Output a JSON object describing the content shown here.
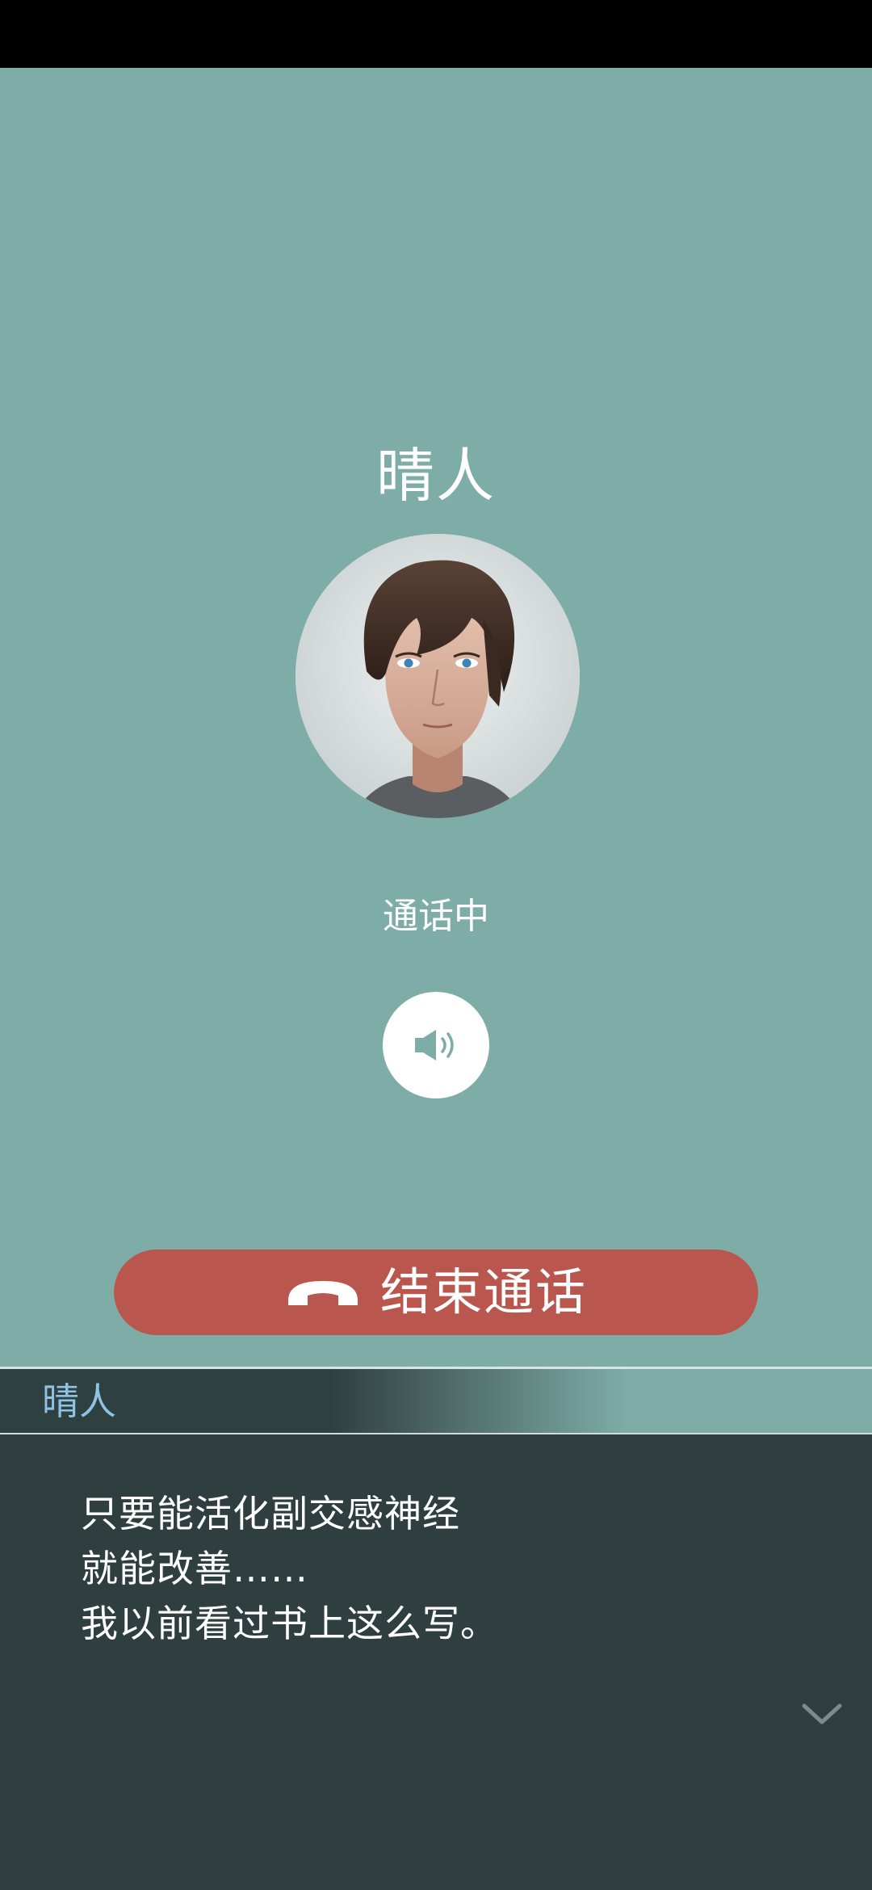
{
  "call": {
    "caller_name": "晴人",
    "status": "通话中",
    "end_call_label": "结束通话"
  },
  "icons": {
    "speaker": "speaker-icon",
    "end_call": "phone-hangup-icon",
    "continue": "chevron-down-icon"
  },
  "dialogue": {
    "speaker": "晴人",
    "lines": [
      "只要能活化副交感神经",
      "就能改善……",
      "我以前看过书上这么写。"
    ]
  },
  "colors": {
    "background": "#7eaca7",
    "end_call_button": "#b9574f",
    "dialogue_box": "#2f3e3e",
    "speaker_name": "#8fc2e3"
  }
}
